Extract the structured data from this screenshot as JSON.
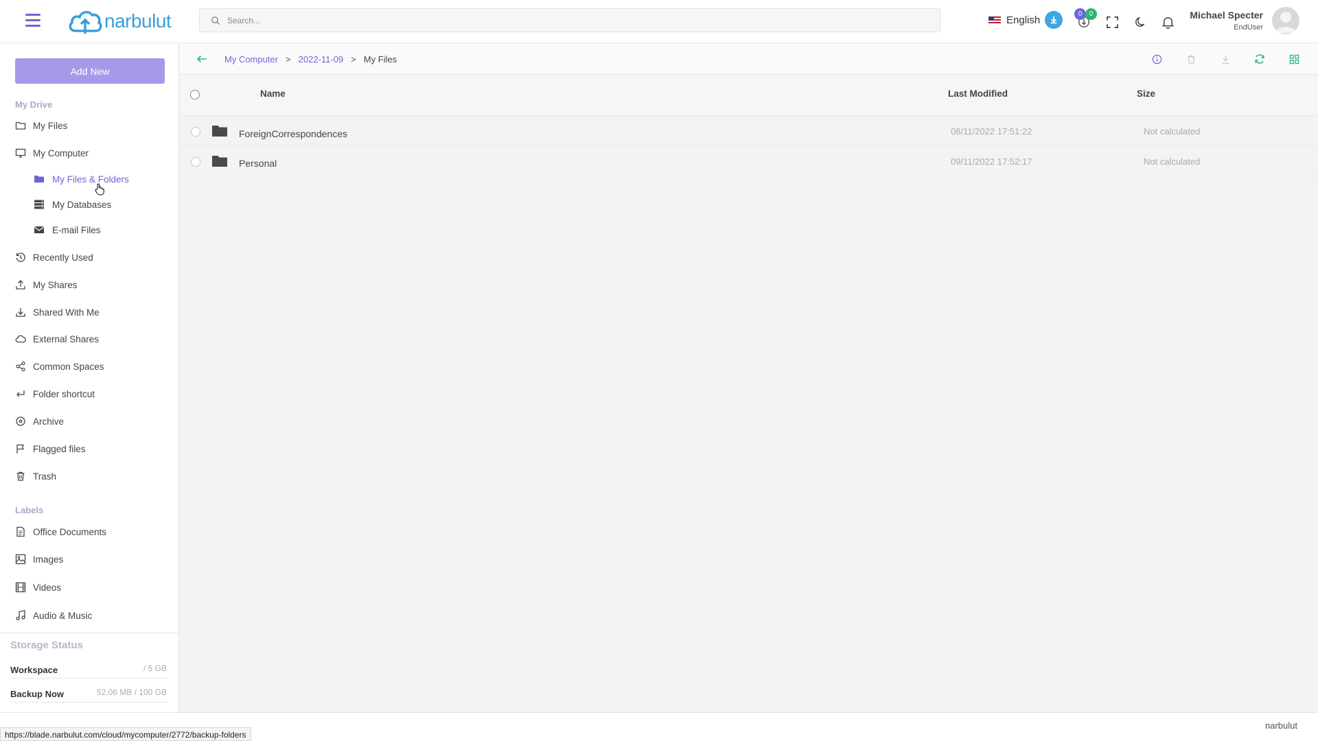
{
  "app": {
    "logo_text": "narbulut",
    "search_placeholder": "Search...",
    "language": "English",
    "upload_badge": "0",
    "download_badge": "0",
    "user_name": "Michael Specter",
    "user_role": "EndUser",
    "accent_color": "#6d64d8"
  },
  "sidebar": {
    "add_new": "Add New",
    "my_drive_title": "My Drive",
    "items": {
      "my_files": "My Files",
      "my_computer": "My Computer",
      "my_files_folders": "My Files & Folders",
      "my_databases": "My Databases",
      "email_files": "E-mail Files",
      "recently_used": "Recently Used",
      "my_shares": "My Shares",
      "shared_with_me": "Shared With Me",
      "external_shares": "External Shares",
      "common_spaces": "Common Spaces",
      "folder_shortcut": "Folder shortcut",
      "archive": "Archive",
      "flagged_files": "Flagged files",
      "trash": "Trash"
    },
    "labels_title": "Labels",
    "labels": {
      "office_documents": "Office Documents",
      "images": "Images",
      "videos": "Videos",
      "audio_music": "Audio & Music"
    },
    "storage": {
      "title": "Storage Status",
      "workspace_label": "Workspace",
      "workspace_value": "/ 5 GB",
      "backup_label": "Backup Now",
      "backup_value": "52.06 MB / 100 GB"
    }
  },
  "main": {
    "breadcrumb": [
      "My Computer",
      "2022-11-09",
      "My Files"
    ],
    "breadcrumb_sep": ">",
    "columns": {
      "name": "Name",
      "modified": "Last Modified",
      "size": "Size"
    },
    "rows": [
      {
        "name": "ForeignCorrespondences",
        "modified": "08/11/2022 17:51:22",
        "size": "Not calculated"
      },
      {
        "name": "Personal",
        "modified": "09/11/2022 17:52:17",
        "size": "Not calculated"
      }
    ]
  },
  "footer": {
    "brand": "narbulut",
    "status_url": "https://blade.narbulut.com/cloud/mycomputer/2772/backup-folders"
  }
}
